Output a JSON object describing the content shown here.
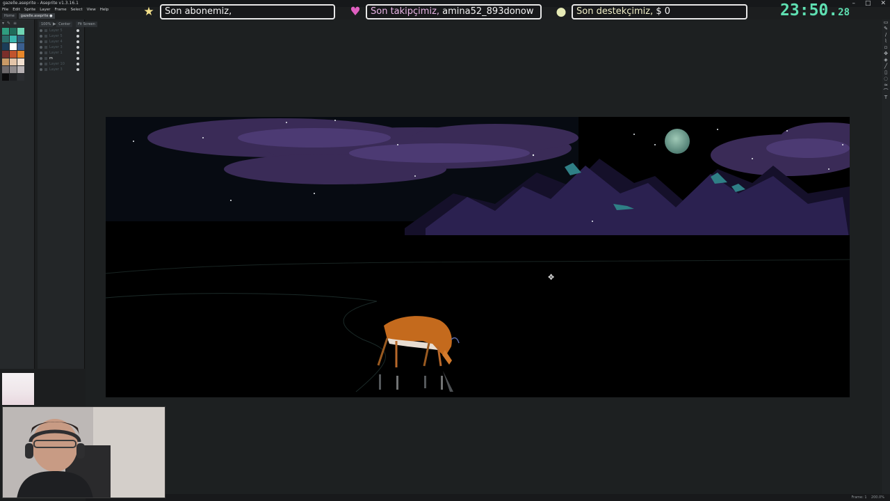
{
  "window": {
    "title": "gazelle.aseprite - Aseprite v1.3.16.1",
    "controls": [
      "–",
      "□",
      "✕"
    ]
  },
  "menu": [
    "File",
    "Edit",
    "Sprite",
    "Layer",
    "Frame",
    "Select",
    "View",
    "Help"
  ],
  "tabs": {
    "home": "Home",
    "file": "gazelle.aseprite ●"
  },
  "editor_tabs": [
    "100%",
    "Center",
    "Fit Screen"
  ],
  "overlay": {
    "subscriber_label": "Son abonemiz,",
    "subscriber_name": "",
    "follower_label": "Son takipçimiz,",
    "follower_name": "amina52_893donow",
    "donor_label": "Son destekçimiz,",
    "donor_amount": "$ 0",
    "clock_main": "23:50.",
    "clock_sub": "28",
    "icons": [
      "star-icon",
      "heart-icon",
      "coin-icon"
    ]
  },
  "palette_colors": [
    "#2f9e7f",
    "#1f6b5a",
    "#6fd6b4",
    "#2a6e6a",
    "#3cb8b0",
    "#2e5f7a",
    "#1b3d58",
    "#ffffff",
    "#3b5f8f",
    "#7a2f2a",
    "#c2542d",
    "#e8872a",
    "#c99a66",
    "#e3c4a8",
    "#f2e0d0",
    "#6e6a6c",
    "#8f8a8c",
    "#b8b2b4",
    "#0b0b0c",
    "#1e1f22",
    "#2c2e32"
  ],
  "layers": [
    {
      "name": "Layer 5",
      "selected": false
    },
    {
      "name": "Layer 5",
      "selected": false
    },
    {
      "name": "Layer 4",
      "selected": false
    },
    {
      "name": "Layer 3",
      "selected": false
    },
    {
      "name": "Layer 1",
      "selected": false
    },
    {
      "name": "m",
      "selected": true
    },
    {
      "name": "Layer 10",
      "selected": false
    },
    {
      "name": "Layer 3",
      "selected": false
    }
  ],
  "status": {
    "frame_label": "Frame:",
    "frame_value": "1",
    "zoom": "200.0%"
  },
  "colors": {
    "overlay_border": "#e8e8e8",
    "clock": "#5fe0b2",
    "star": "#f3e08a",
    "heart": "#e05fc0",
    "coin": "#e6eab5"
  }
}
